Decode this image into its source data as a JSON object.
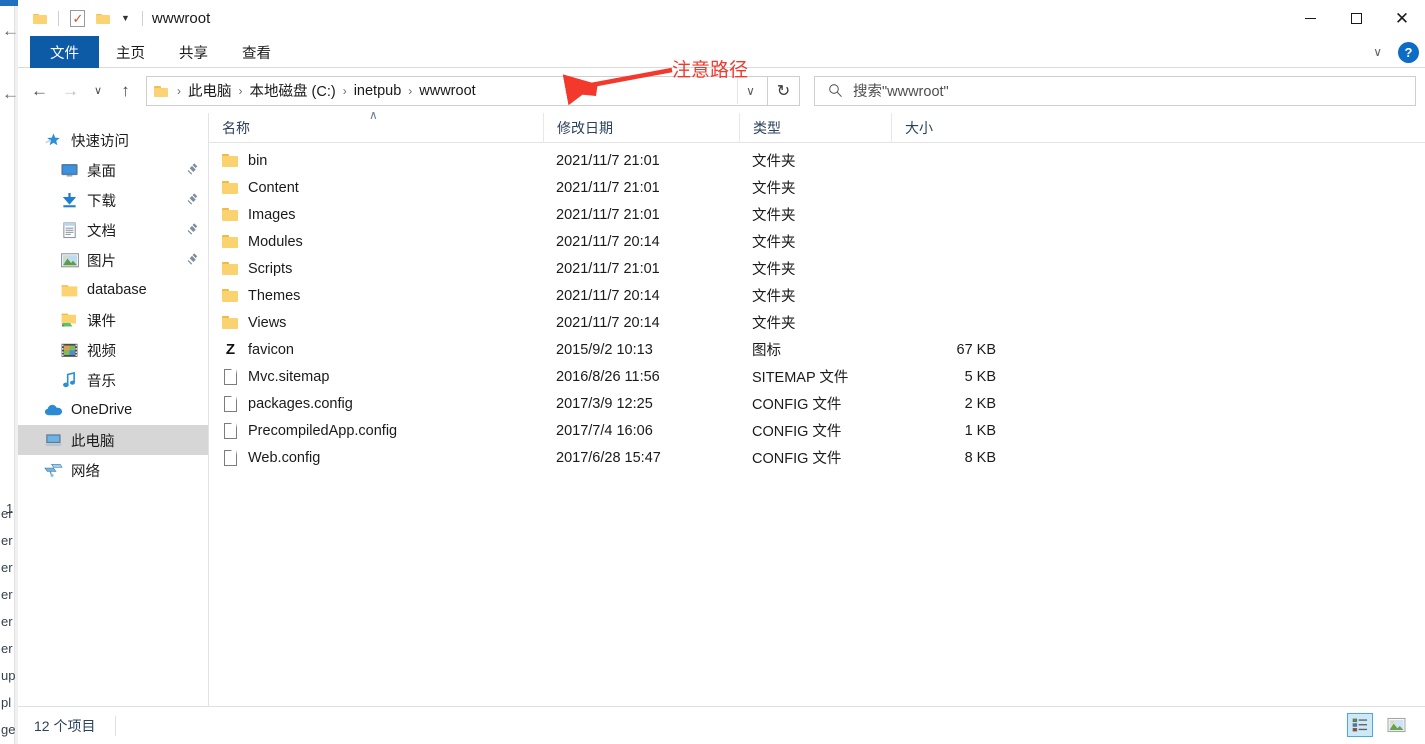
{
  "window": {
    "title": "wwwroot",
    "quick_access": [
      {
        "name": "folder-icon",
        "label": ""
      },
      {
        "name": "properties-icon",
        "label": ""
      },
      {
        "name": "new-folder-icon",
        "label": ""
      }
    ],
    "caption": {
      "minimize": "—",
      "maximize": "□",
      "close": "✕"
    }
  },
  "ribbon": {
    "tabs": [
      {
        "label": "文件",
        "active": true
      },
      {
        "label": "主页",
        "active": false
      },
      {
        "label": "共享",
        "active": false
      },
      {
        "label": "查看",
        "active": false
      }
    ],
    "collapse_caret": "∨",
    "help_label": "?"
  },
  "navigation": {
    "back": "←",
    "forward": "→",
    "recent_caret": "∨",
    "up": "↑",
    "refresh": "↻",
    "address_caret": "∨",
    "breadcrumbs": [
      "此电脑",
      "本地磁盘 (C:)",
      "inetpub",
      "wwwroot"
    ],
    "separator": "›"
  },
  "search": {
    "placeholder": "搜索\"wwwroot\"",
    "value": ""
  },
  "sidebar": {
    "items": [
      {
        "label": "快速访问",
        "icon": "star-pin-icon",
        "level": 0,
        "pinned": false,
        "selected": false
      },
      {
        "label": "桌面",
        "icon": "desktop-icon",
        "level": 1,
        "pinned": true,
        "selected": false
      },
      {
        "label": "下载",
        "icon": "download-icon",
        "level": 1,
        "pinned": true,
        "selected": false
      },
      {
        "label": "文档",
        "icon": "documents-icon",
        "level": 1,
        "pinned": true,
        "selected": false
      },
      {
        "label": "图片",
        "icon": "pictures-icon",
        "level": 1,
        "pinned": true,
        "selected": false
      },
      {
        "label": "database",
        "icon": "folder-icon",
        "level": 1,
        "pinned": false,
        "selected": false
      },
      {
        "label": "课件",
        "icon": "shared-folder-icon",
        "level": 1,
        "pinned": false,
        "selected": false
      },
      {
        "label": "视频",
        "icon": "videos-icon",
        "level": 1,
        "pinned": false,
        "selected": false
      },
      {
        "label": "音乐",
        "icon": "music-icon",
        "level": 1,
        "pinned": false,
        "selected": false
      },
      {
        "label": "OneDrive",
        "icon": "onedrive-icon",
        "level": 0,
        "pinned": false,
        "selected": false
      },
      {
        "label": "此电脑",
        "icon": "this-pc-icon",
        "level": 0,
        "pinned": false,
        "selected": true
      },
      {
        "label": "网络",
        "icon": "network-icon",
        "level": 0,
        "pinned": false,
        "selected": false
      }
    ]
  },
  "file_list": {
    "columns": [
      {
        "label": "名称",
        "sorted": "asc"
      },
      {
        "label": "修改日期",
        "sorted": ""
      },
      {
        "label": "类型",
        "sorted": ""
      },
      {
        "label": "大小",
        "sorted": ""
      }
    ],
    "sort_indicator": "∧",
    "rows": [
      {
        "name": "bin",
        "date": "2021/11/7 21:01",
        "type": "文件夹",
        "size": "",
        "icon": "folder-icon"
      },
      {
        "name": "Content",
        "date": "2021/11/7 21:01",
        "type": "文件夹",
        "size": "",
        "icon": "folder-icon"
      },
      {
        "name": "Images",
        "date": "2021/11/7 21:01",
        "type": "文件夹",
        "size": "",
        "icon": "folder-icon"
      },
      {
        "name": "Modules",
        "date": "2021/11/7 20:14",
        "type": "文件夹",
        "size": "",
        "icon": "folder-icon"
      },
      {
        "name": "Scripts",
        "date": "2021/11/7 21:01",
        "type": "文件夹",
        "size": "",
        "icon": "folder-icon"
      },
      {
        "name": "Themes",
        "date": "2021/11/7 20:14",
        "type": "文件夹",
        "size": "",
        "icon": "folder-icon"
      },
      {
        "name": "Views",
        "date": "2021/11/7 20:14",
        "type": "文件夹",
        "size": "",
        "icon": "folder-icon"
      },
      {
        "name": "favicon",
        "date": "2015/9/2 10:13",
        "type": "图标",
        "size": "67 KB",
        "icon": "z-file-icon"
      },
      {
        "name": "Mvc.sitemap",
        "date": "2016/8/26 11:56",
        "type": "SITEMAP 文件",
        "size": "5 KB",
        "icon": "document-icon"
      },
      {
        "name": "packages.config",
        "date": "2017/3/9 12:25",
        "type": "CONFIG 文件",
        "size": "2 KB",
        "icon": "document-icon"
      },
      {
        "name": "PrecompiledApp.config",
        "date": "2017/7/4 16:06",
        "type": "CONFIG 文件",
        "size": "1 KB",
        "icon": "document-icon"
      },
      {
        "name": "Web.config",
        "date": "2017/6/28 15:47",
        "type": "CONFIG 文件",
        "size": "8 KB",
        "icon": "document-icon"
      }
    ]
  },
  "statusbar": {
    "item_count": "12 个项目",
    "views": [
      {
        "name": "details-view-button",
        "active": true
      },
      {
        "name": "large-icons-view-button",
        "active": false
      }
    ]
  },
  "annotation": {
    "text": "注意路径",
    "color": "#f2392c",
    "arrow": "left-pointing-arrow"
  },
  "background_window": {
    "number_fragment": "1",
    "text_fragments": [
      "er",
      "er",
      "er",
      "er",
      "er",
      "er",
      "up",
      "pl",
      "ge"
    ]
  }
}
